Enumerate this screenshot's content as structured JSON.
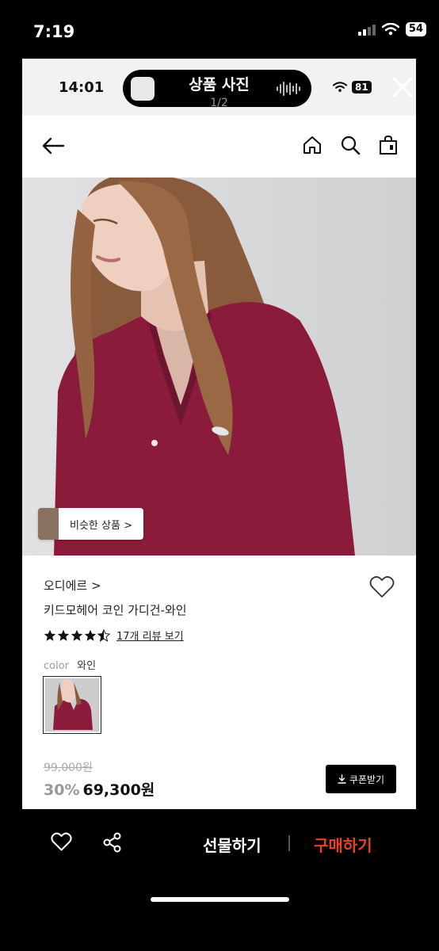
{
  "os_status": {
    "time": "7:19",
    "battery": "54"
  },
  "inner_status": {
    "time": "14:01",
    "battery": "81"
  },
  "viewer": {
    "title": "상품 사진",
    "counter": "1/2"
  },
  "image": {
    "similar_label": "비슷한 상품 >"
  },
  "product": {
    "brand": "오디에르 >",
    "name": "키드모헤어 코인 가디건-와인",
    "rating": 4.5,
    "review_link": "17개 리뷰 보기",
    "color_label": "color",
    "color_value": "와인",
    "original_price": "99,000원",
    "discount": "30%",
    "price": "69,300원",
    "coupon_label": "쿠폰받기"
  },
  "bottom_bar": {
    "gift_label": "선물하기",
    "buy_label": "구매하기"
  },
  "colors": {
    "accent_buy": "#e8412a",
    "cardigan": "#8a1b3a"
  },
  "icons": [
    "back-arrow-icon",
    "home-icon",
    "search-icon",
    "shopping-bag-icon",
    "heart-icon",
    "share-icon",
    "close-icon",
    "download-icon"
  ]
}
